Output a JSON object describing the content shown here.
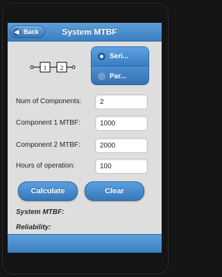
{
  "header": {
    "back_label": "Back",
    "title": "System MTBF"
  },
  "diagram": {
    "block1": "1",
    "block2": "2"
  },
  "config": {
    "options": [
      "Seri...",
      "Par..."
    ],
    "selected": "Seri..."
  },
  "fields": [
    {
      "label": "Num of Components:",
      "value": "2"
    },
    {
      "label": "Component 1 MTBF:",
      "value": "1000"
    },
    {
      "label": "Component 2 MTBF:",
      "value": "2000"
    },
    {
      "label": "Hours of operation:",
      "value": "100"
    }
  ],
  "actions": {
    "calculate_label": "Calculate",
    "clear_label": "Clear"
  },
  "results": {
    "mtbf_label": "System MTBF:",
    "reliability_label": "Reliability:"
  }
}
